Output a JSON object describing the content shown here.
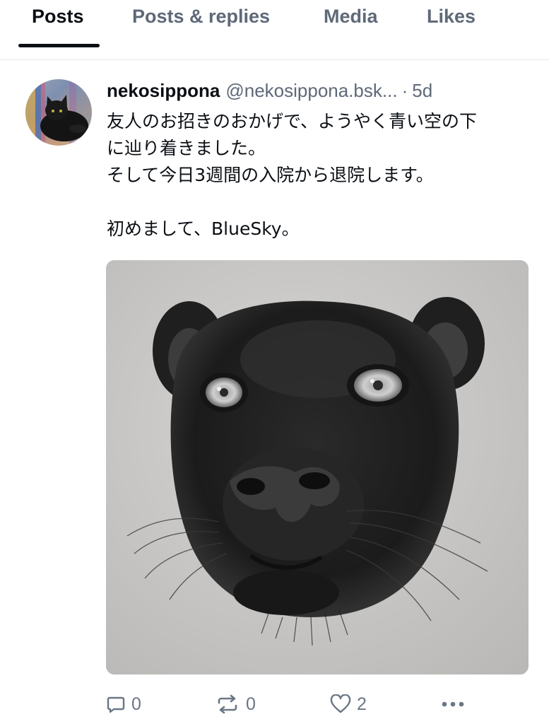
{
  "tabs": [
    {
      "label": "Posts",
      "active": true
    },
    {
      "label": "Posts & replies",
      "active": false
    },
    {
      "label": "Media",
      "active": false
    },
    {
      "label": "Likes",
      "active": false
    }
  ],
  "post": {
    "display_name": "nekosippona",
    "handle": "@nekosippona.bsk...",
    "separator": "·",
    "time": "5d",
    "text_lines": [
      "友人のお招きのおかげで、ようやく青い空の下",
      "に辿り着きました。",
      "そして今日3週間の入院から退院します。",
      "",
      "初めまして、BlueSky。"
    ],
    "image_subject": "pencil drawing of a black panther face",
    "avatar_subject": "black cat",
    "actions": {
      "reply_count": "0",
      "repost_count": "0",
      "like_count": "2"
    }
  },
  "icons": {
    "reply": "speech-bubble-icon",
    "repost": "repost-arrows-icon",
    "like": "heart-icon",
    "more": "more-dots-icon"
  },
  "colors": {
    "text": "#0b0f14",
    "muted": "#5e6978",
    "divider": "#e3e6ea"
  }
}
